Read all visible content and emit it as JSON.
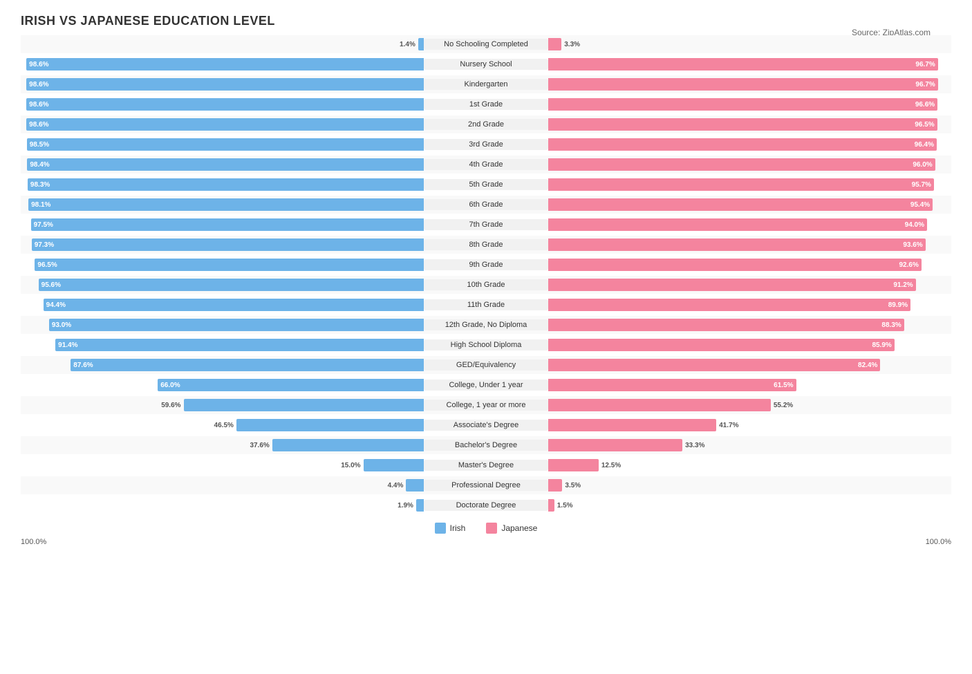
{
  "title": "IRISH VS JAPANESE EDUCATION LEVEL",
  "source": "Source: ZipAtlas.com",
  "colors": {
    "irish": "#6db3e8",
    "japanese": "#f4849e"
  },
  "legend": {
    "irish": "Irish",
    "japanese": "Japanese"
  },
  "axis": {
    "left": "100.0%",
    "right": "100.0%"
  },
  "rows": [
    {
      "label": "No Schooling Completed",
      "irish": 1.4,
      "japanese": 3.3,
      "irishLabel": "1.4%",
      "japaneseLabel": "3.3%",
      "irishInside": false,
      "japaneseInside": false
    },
    {
      "label": "Nursery School",
      "irish": 98.6,
      "japanese": 96.7,
      "irishLabel": "98.6%",
      "japaneseLabel": "96.7%",
      "irishInside": true,
      "japaneseInside": true
    },
    {
      "label": "Kindergarten",
      "irish": 98.6,
      "japanese": 96.7,
      "irishLabel": "98.6%",
      "japaneseLabel": "96.7%",
      "irishInside": true,
      "japaneseInside": true
    },
    {
      "label": "1st Grade",
      "irish": 98.6,
      "japanese": 96.6,
      "irishLabel": "98.6%",
      "japaneseLabel": "96.6%",
      "irishInside": true,
      "japaneseInside": true
    },
    {
      "label": "2nd Grade",
      "irish": 98.6,
      "japanese": 96.5,
      "irishLabel": "98.6%",
      "japaneseLabel": "96.5%",
      "irishInside": true,
      "japaneseInside": true
    },
    {
      "label": "3rd Grade",
      "irish": 98.5,
      "japanese": 96.4,
      "irishLabel": "98.5%",
      "japaneseLabel": "96.4%",
      "irishInside": true,
      "japaneseInside": true
    },
    {
      "label": "4th Grade",
      "irish": 98.4,
      "japanese": 96.0,
      "irishLabel": "98.4%",
      "japaneseLabel": "96.0%",
      "irishInside": true,
      "japaneseInside": true
    },
    {
      "label": "5th Grade",
      "irish": 98.3,
      "japanese": 95.7,
      "irishLabel": "98.3%",
      "japaneseLabel": "95.7%",
      "irishInside": true,
      "japaneseInside": true
    },
    {
      "label": "6th Grade",
      "irish": 98.1,
      "japanese": 95.4,
      "irishLabel": "98.1%",
      "japaneseLabel": "95.4%",
      "irishInside": true,
      "japaneseInside": true
    },
    {
      "label": "7th Grade",
      "irish": 97.5,
      "japanese": 94.0,
      "irishLabel": "97.5%",
      "japaneseLabel": "94.0%",
      "irishInside": true,
      "japaneseInside": true
    },
    {
      "label": "8th Grade",
      "irish": 97.3,
      "japanese": 93.6,
      "irishLabel": "97.3%",
      "japaneseLabel": "93.6%",
      "irishInside": true,
      "japaneseInside": true
    },
    {
      "label": "9th Grade",
      "irish": 96.5,
      "japanese": 92.6,
      "irishLabel": "96.5%",
      "japaneseLabel": "92.6%",
      "irishInside": true,
      "japaneseInside": true
    },
    {
      "label": "10th Grade",
      "irish": 95.6,
      "japanese": 91.2,
      "irishLabel": "95.6%",
      "japaneseLabel": "91.2%",
      "irishInside": true,
      "japaneseInside": true
    },
    {
      "label": "11th Grade",
      "irish": 94.4,
      "japanese": 89.9,
      "irishLabel": "94.4%",
      "japaneseLabel": "89.9%",
      "irishInside": true,
      "japaneseInside": true
    },
    {
      "label": "12th Grade, No Diploma",
      "irish": 93.0,
      "japanese": 88.3,
      "irishLabel": "93.0%",
      "japaneseLabel": "88.3%",
      "irishInside": true,
      "japaneseInside": true
    },
    {
      "label": "High School Diploma",
      "irish": 91.4,
      "japanese": 85.9,
      "irishLabel": "91.4%",
      "japaneseLabel": "85.9%",
      "irishInside": true,
      "japaneseInside": true
    },
    {
      "label": "GED/Equivalency",
      "irish": 87.6,
      "japanese": 82.4,
      "irishLabel": "87.6%",
      "japaneseLabel": "82.4%",
      "irishInside": true,
      "japaneseInside": true
    },
    {
      "label": "College, Under 1 year",
      "irish": 66.0,
      "japanese": 61.5,
      "irishLabel": "66.0%",
      "japaneseLabel": "61.5%",
      "irishInside": true,
      "japaneseInside": true
    },
    {
      "label": "College, 1 year or more",
      "irish": 59.6,
      "japanese": 55.2,
      "irishLabel": "59.6%",
      "japaneseLabel": "55.2%",
      "irishInside": false,
      "japaneseInside": false
    },
    {
      "label": "Associate's Degree",
      "irish": 46.5,
      "japanese": 41.7,
      "irishLabel": "46.5%",
      "japaneseLabel": "41.7%",
      "irishInside": false,
      "japaneseInside": false
    },
    {
      "label": "Bachelor's Degree",
      "irish": 37.6,
      "japanese": 33.3,
      "irishLabel": "37.6%",
      "japaneseLabel": "33.3%",
      "irishInside": false,
      "japaneseInside": false
    },
    {
      "label": "Master's Degree",
      "irish": 15.0,
      "japanese": 12.5,
      "irishLabel": "15.0%",
      "japaneseLabel": "12.5%",
      "irishInside": false,
      "japaneseInside": false
    },
    {
      "label": "Professional Degree",
      "irish": 4.4,
      "japanese": 3.5,
      "irishLabel": "4.4%",
      "japaneseLabel": "3.5%",
      "irishInside": false,
      "japaneseInside": false
    },
    {
      "label": "Doctorate Degree",
      "irish": 1.9,
      "japanese": 1.5,
      "irishLabel": "1.9%",
      "japaneseLabel": "1.5%",
      "irishInside": false,
      "japaneseInside": false
    }
  ]
}
